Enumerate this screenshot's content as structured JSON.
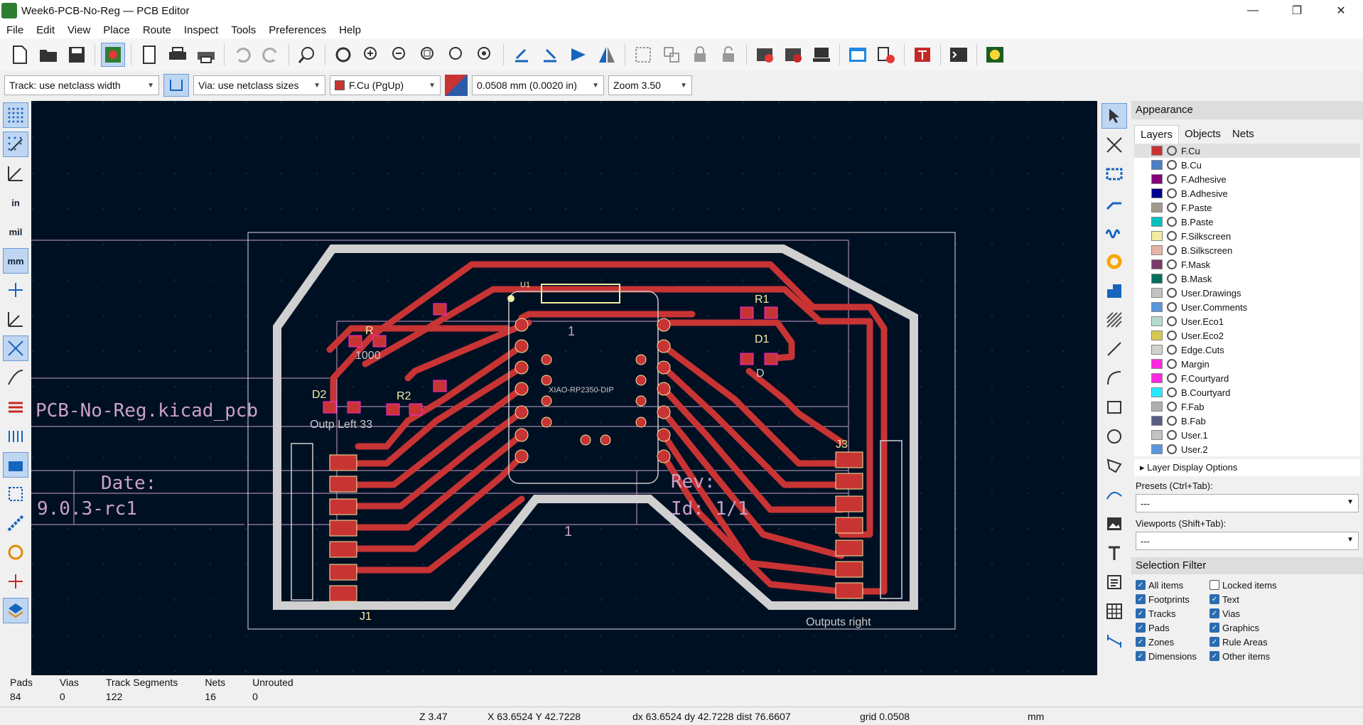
{
  "window": {
    "title": "Week6-PCB-No-Reg — PCB Editor",
    "minimize": "—",
    "maximize": "❐",
    "close": "✕"
  },
  "menu": [
    "File",
    "Edit",
    "View",
    "Place",
    "Route",
    "Inspect",
    "Tools",
    "Preferences",
    "Help"
  ],
  "toolbar2": {
    "track": "Track: use netclass width",
    "via": "Via: use netclass sizes",
    "layer": "F.Cu (PgUp)",
    "grid": "0.0508 mm (0.0020 in)",
    "zoom": "Zoom 3.50"
  },
  "left_tools": {
    "in": "in",
    "mil": "mil",
    "mm": "mm"
  },
  "canvas": {
    "drawing_text": "PCB-No-Reg.kicad_pcb",
    "date_label": "Date:",
    "version": "9.0.3-rc1",
    "sheet_num": "1",
    "sheet_num2": "1",
    "rev": "Rev:",
    "id": "Id: 1/1",
    "u1": "U1",
    "u1_value": "XIAO-RP2350-DIP",
    "r1": "R1",
    "r2": "R2",
    "r3": "R",
    "d1": "D1",
    "d2": "D2",
    "d3": "D",
    "j1": "J1",
    "j3": "J3",
    "res_val": "1000",
    "left_text": "Outp Left 33",
    "right_text": "Outputs right",
    "pin1": "1"
  },
  "panel": {
    "title": "Appearance",
    "tabs": [
      "Layers",
      "Objects",
      "Nets"
    ],
    "layers": [
      {
        "name": "F.Cu",
        "color": "#c83434"
      },
      {
        "name": "B.Cu",
        "color": "#4d7fc4"
      },
      {
        "name": "F.Adhesive",
        "color": "#84007c"
      },
      {
        "name": "B.Adhesive",
        "color": "#00008f"
      },
      {
        "name": "F.Paste",
        "color": "#a09a8f"
      },
      {
        "name": "B.Paste",
        "color": "#00c2c2"
      },
      {
        "name": "F.Silkscreen",
        "color": "#f2eda1"
      },
      {
        "name": "B.Silkscreen",
        "color": "#e8b2a7"
      },
      {
        "name": "F.Mask",
        "color": "#7a3a6a"
      },
      {
        "name": "B.Mask",
        "color": "#02705b"
      },
      {
        "name": "User.Drawings",
        "color": "#c2c2c2"
      },
      {
        "name": "User.Comments",
        "color": "#5996dd"
      },
      {
        "name": "User.Eco1",
        "color": "#b4dbd2"
      },
      {
        "name": "User.Eco2",
        "color": "#d8c852"
      },
      {
        "name": "Edge.Cuts",
        "color": "#d0d2cd"
      },
      {
        "name": "Margin",
        "color": "#ff26e2"
      },
      {
        "name": "F.Courtyard",
        "color": "#ff26e2"
      },
      {
        "name": "B.Courtyard",
        "color": "#26e9ff"
      },
      {
        "name": "F.Fab",
        "color": "#afafaf"
      },
      {
        "name": "B.Fab",
        "color": "#585d84"
      },
      {
        "name": "User.1",
        "color": "#c2c2c2"
      },
      {
        "name": "User.2",
        "color": "#5996dd"
      }
    ],
    "layer_display_options": "Layer Display Options",
    "presets_label": "Presets (Ctrl+Tab):",
    "presets_value": "---",
    "viewports_label": "Viewports (Shift+Tab):",
    "viewports_value": "---",
    "selection_filter": "Selection Filter",
    "filters": [
      {
        "label": "All items",
        "checked": true
      },
      {
        "label": "Locked items",
        "checked": false
      },
      {
        "label": "Footprints",
        "checked": true
      },
      {
        "label": "Text",
        "checked": true
      },
      {
        "label": "Tracks",
        "checked": true
      },
      {
        "label": "Vias",
        "checked": true
      },
      {
        "label": "Pads",
        "checked": true
      },
      {
        "label": "Graphics",
        "checked": true
      },
      {
        "label": "Zones",
        "checked": true
      },
      {
        "label": "Rule Areas",
        "checked": true
      },
      {
        "label": "Dimensions",
        "checked": true
      },
      {
        "label": "Other items",
        "checked": true
      }
    ]
  },
  "messages": [
    {
      "label": "Pads",
      "value": "84"
    },
    {
      "label": "Vias",
      "value": "0"
    },
    {
      "label": "Track Segments",
      "value": "122"
    },
    {
      "label": "Nets",
      "value": "16"
    },
    {
      "label": "Unrouted",
      "value": "0"
    }
  ],
  "status": {
    "z": "Z 3.47",
    "xy": "X 63.6524  Y 42.7228",
    "dxy": "dx 63.6524  dy 42.7228  dist 76.6607",
    "grid": "grid 0.0508",
    "units": "mm"
  }
}
